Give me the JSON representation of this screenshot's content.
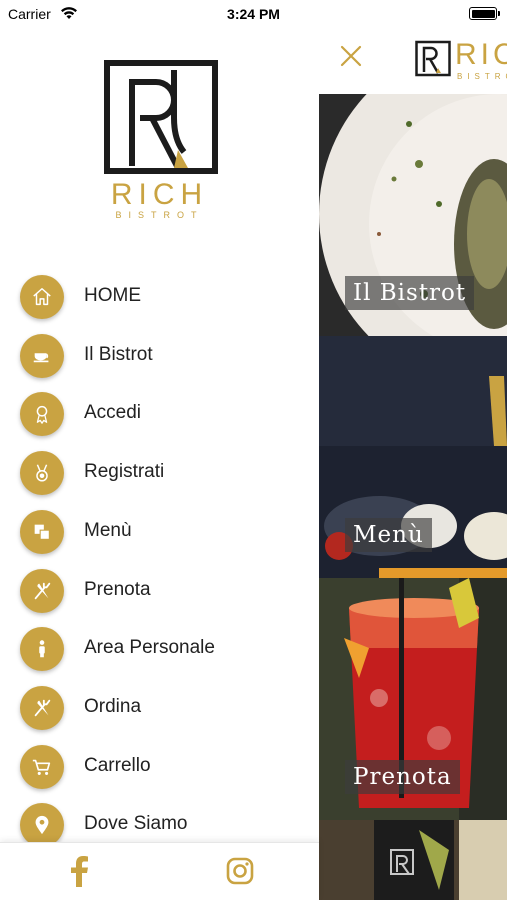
{
  "status_bar": {
    "carrier": "Carrier",
    "time": "3:24 PM"
  },
  "brand": {
    "name": "RICH",
    "tagline": "BISTROT",
    "accent_color": "#c9a342"
  },
  "menu": {
    "items": [
      {
        "label": "HOME",
        "icon": "home-icon"
      },
      {
        "label": "Il Bistrot",
        "icon": "cup-icon"
      },
      {
        "label": "Accedi",
        "icon": "ribbon-icon"
      },
      {
        "label": "Registrati",
        "icon": "medal-icon"
      },
      {
        "label": "Menù",
        "icon": "squares-icon"
      },
      {
        "label": "Prenota",
        "icon": "cutlery-icon"
      },
      {
        "label": "Area Personale",
        "icon": "person-icon"
      },
      {
        "label": "Ordina",
        "icon": "cutlery-icon"
      },
      {
        "label": "Carrello",
        "icon": "cart-icon"
      },
      {
        "label": "Dove Siamo",
        "icon": "location-pin-icon"
      }
    ]
  },
  "footer": {
    "links": [
      "facebook-icon",
      "instagram-icon"
    ]
  },
  "content": {
    "tiles": [
      {
        "caption": "Il Bistrot"
      },
      {
        "caption": "Menù"
      },
      {
        "caption": "Prenota"
      },
      {
        "caption": ""
      }
    ]
  }
}
